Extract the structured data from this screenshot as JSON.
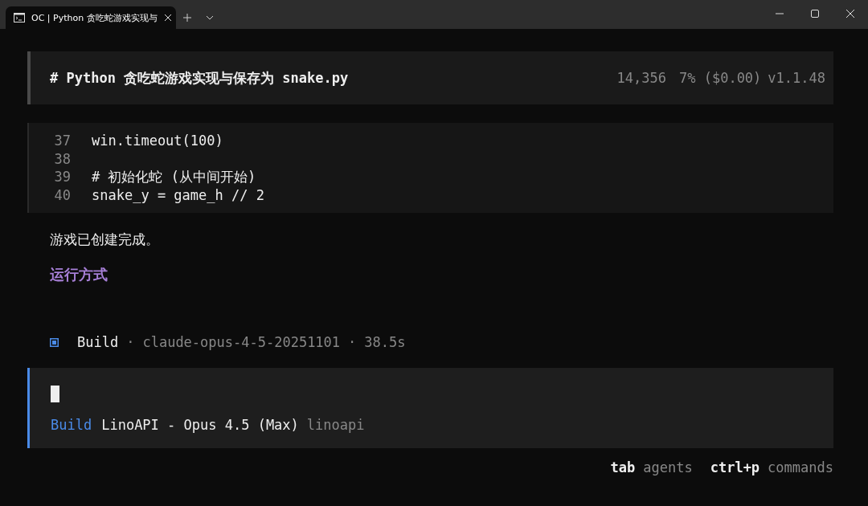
{
  "window": {
    "tabs": [
      {
        "title": "OC | Python 贪吃蛇游戏实现与",
        "selected": true
      }
    ]
  },
  "header": {
    "title": "# Python 贪吃蛇游戏实现与保存为 snake.py",
    "tokens": "14,356",
    "usage": "7% ($0.00)",
    "version": "v1.1.48"
  },
  "code": {
    "lines": [
      {
        "number": "37",
        "text": "win.timeout(100)"
      },
      {
        "number": "38"
      },
      {
        "number": "39",
        "text": "# 初始化蛇 (从中间开始)"
      },
      {
        "number": "40",
        "text": "snake_y = game_h // 2"
      }
    ]
  },
  "message": "游戏已创建完成。",
  "heading": "运行方式",
  "run": {
    "agent": "Build",
    "separator": "·",
    "model": "claude-opus-4-5-20251101",
    "duration": "38.5s"
  },
  "prompt": {
    "agent": "Build",
    "model": "LinoAPI - Opus 4.5 (Max)",
    "provider": "linoapi"
  },
  "hints": [
    {
      "key": "tab",
      "label": "agents"
    },
    {
      "key": "ctrl+p",
      "label": "commands"
    }
  ]
}
